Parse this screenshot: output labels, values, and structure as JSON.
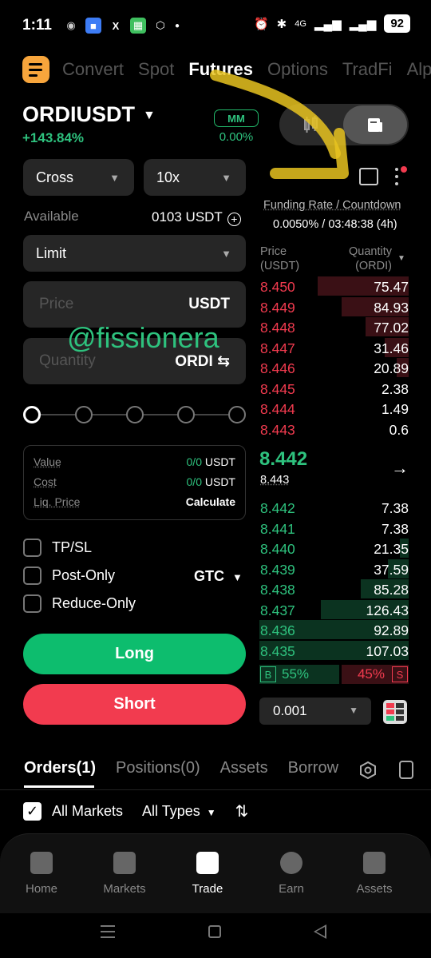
{
  "status": {
    "time": "1:11",
    "network": "4G",
    "battery": "92"
  },
  "top_tabs": [
    "Convert",
    "Spot",
    "Futures",
    "Options",
    "TradFi",
    "Alp"
  ],
  "active_top_tab": "Futures",
  "pair": {
    "symbol": "ORDIUSDT",
    "change": "+143.84%",
    "mm_label": "MM",
    "mm_value": "0.00%"
  },
  "order_form": {
    "margin_mode": "Cross",
    "leverage": "10x",
    "available_label": "Available",
    "available_value": "0103 USDT",
    "order_type": "Limit",
    "price_placeholder": "Price",
    "price_unit": "USDT",
    "quantity_placeholder": "Quantity",
    "quantity_unit": "ORDI",
    "watermark": "@fissionera",
    "summary": {
      "value_label": "Value",
      "value_val": "0/0",
      "value_unit": "USDT",
      "cost_label": "Cost",
      "cost_val": "0/0",
      "cost_unit": "USDT",
      "liq_label": "Liq. Price",
      "liq_action": "Calculate"
    },
    "options": {
      "tpsl": "TP/SL",
      "post_only": "Post-Only",
      "reduce_only": "Reduce-Only",
      "time_in_force": "GTC"
    },
    "long_label": "Long",
    "short_label": "Short"
  },
  "funding": {
    "label": "Funding Rate / Countdown",
    "value": "0.0050% / 03:48:38 (4h)"
  },
  "orderbook": {
    "price_header_1": "Price",
    "price_header_2": "(USDT)",
    "qty_header_1": "Quantity",
    "qty_header_2": "(ORDI)",
    "asks": [
      {
        "price": "8.450",
        "qty": "75.47",
        "depth": 0.61
      },
      {
        "price": "8.449",
        "qty": "84.93",
        "depth": 0.45
      },
      {
        "price": "8.448",
        "qty": "77.02",
        "depth": 0.29
      },
      {
        "price": "8.447",
        "qty": "31.46",
        "depth": 0.16
      },
      {
        "price": "8.446",
        "qty": "20.89",
        "depth": 0.08
      },
      {
        "price": "8.445",
        "qty": "2.38",
        "depth": 0
      },
      {
        "price": "8.444",
        "qty": "1.49",
        "depth": 0
      },
      {
        "price": "8.443",
        "qty": "0.6",
        "depth": 0
      }
    ],
    "mid_price": "8.442",
    "mark_price": "8.443",
    "bids": [
      {
        "price": "8.442",
        "qty": "7.38",
        "depth": 0
      },
      {
        "price": "8.441",
        "qty": "7.38",
        "depth": 0
      },
      {
        "price": "8.440",
        "qty": "21.35",
        "depth": 0.06
      },
      {
        "price": "8.439",
        "qty": "37.59",
        "depth": 0.14
      },
      {
        "price": "8.438",
        "qty": "85.28",
        "depth": 0.32
      },
      {
        "price": "8.437",
        "qty": "126.43",
        "depth": 0.59
      },
      {
        "price": "8.436",
        "qty": "92.89",
        "depth": 1.0
      },
      {
        "price": "8.435",
        "qty": "107.03",
        "depth": 1.0
      }
    ],
    "buy_label": "B",
    "buy_pct": "55%",
    "sell_pct": "45%",
    "sell_label": "S",
    "precision": "0.001"
  },
  "bottom_tabs": [
    "Orders(1)",
    "Positions(0)",
    "Assets",
    "Borrow"
  ],
  "filters": {
    "all_markets": "All Markets",
    "all_types": "All Types"
  },
  "nav": [
    "Home",
    "Markets",
    "Trade",
    "Earn",
    "Assets"
  ],
  "active_nav": "Trade",
  "colors": {
    "accent_green": "#2ec27e",
    "accent_red": "#f23b4f",
    "brand_orange": "#f7a53c"
  }
}
